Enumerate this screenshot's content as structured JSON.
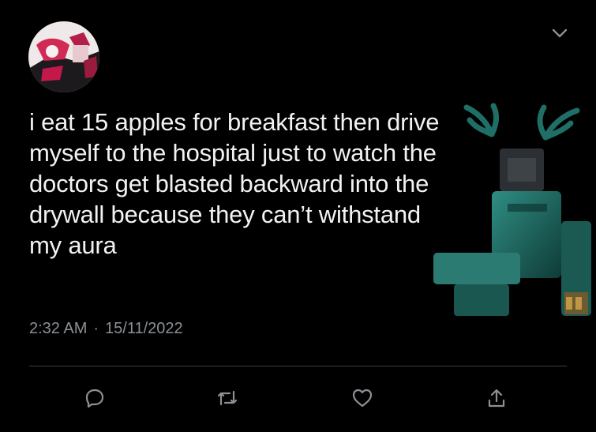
{
  "tweet": {
    "text": "i eat 15 apples for breakfast then drive\nmyself to the hospital just to watch the\ndoctors get blasted backward into the\ndrywall because they can’t withstand\nmy aura",
    "time": "2:32 AM",
    "separator": "·",
    "date": "15/11/2022"
  },
  "icons": {
    "menu": "chevron-down-icon",
    "reply": "reply-icon",
    "retweet": "retweet-icon",
    "like": "heart-icon",
    "share": "share-icon"
  },
  "colors": {
    "background": "#000000",
    "text": "#f2f2f2",
    "meta": "#8b9096",
    "icon": "#8b9096",
    "art_teal": "#1f6f66"
  }
}
